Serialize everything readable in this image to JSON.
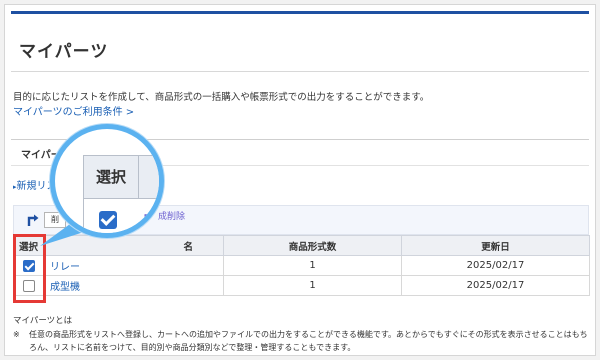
{
  "page": {
    "title": "マイパーツ",
    "description": "目的に応じたリストを作成して、商品形式の一括購入や帳票形式での出力をすることができます。",
    "terms_link": "マイパーツのご利用条件 >",
    "registered_label": "マイパーツ登録",
    "new_list_link": "新規リスト"
  },
  "toolbar": {
    "delete_label": "削",
    "delete_suffix": "成削除"
  },
  "table": {
    "headers": [
      "選択",
      "名",
      "商品形式数",
      "更新日"
    ],
    "rows": [
      {
        "checked": true,
        "name": "リレー",
        "count": "1",
        "updated": "2025/02/17"
      },
      {
        "checked": false,
        "name": "成型機",
        "count": "1",
        "updated": "2025/02/17"
      }
    ]
  },
  "magnifier": {
    "header": "選択",
    "text": "成"
  },
  "footnote": {
    "title": "マイパーツとは",
    "mark": "※",
    "text": "任意の商品形式をリストへ登録し、カートへの追加やファイルでの出力をすることができる機能です。あとからでもすぐにその形式を表示させることはもちろん、リストに名前をつけて、目的別や商品分類別などで整理・管理することもできます。"
  },
  "colors": {
    "accent": "#1e50a2",
    "link": "#1a5fb4",
    "highlight_red": "#e53935",
    "magnifier_ring": "#5bb2f0",
    "checkbox": "#2a6cc8"
  }
}
